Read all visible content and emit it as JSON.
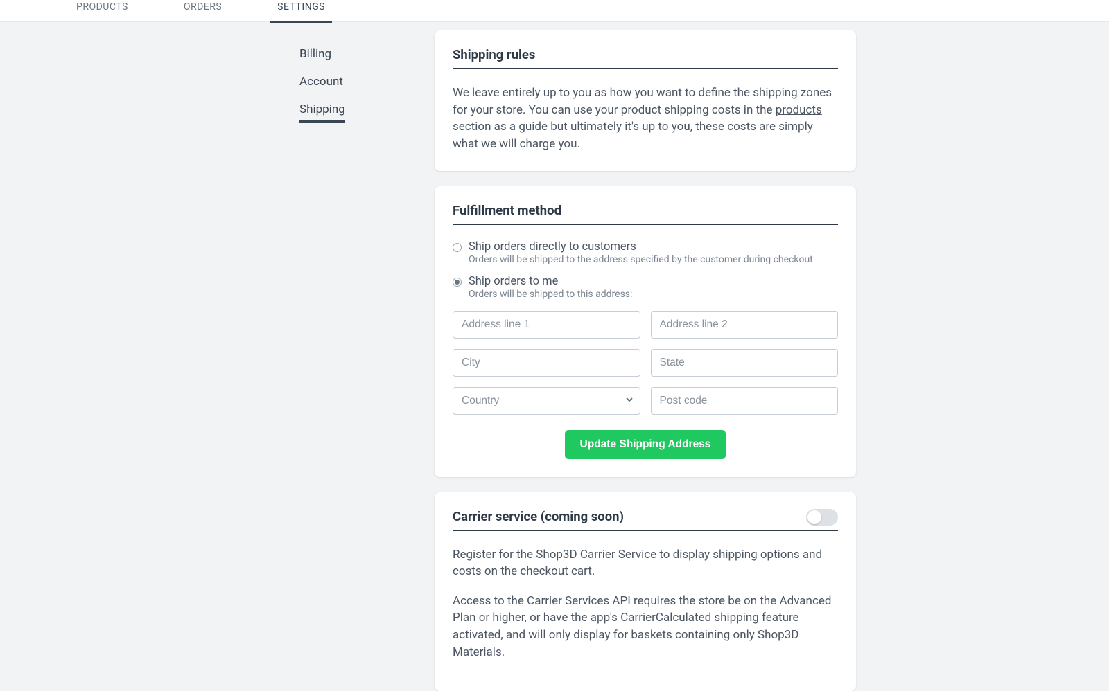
{
  "topnav": {
    "products": "PRODUCTS",
    "orders": "ORDERS",
    "settings": "SETTINGS"
  },
  "sidemenu": {
    "billing": "Billing",
    "account": "Account",
    "shipping": "Shipping"
  },
  "shipping_rules": {
    "title": "Shipping rules",
    "desc_1": "We leave entirely up to you as how you want to define the shipping zones for your store. You can use your product shipping costs in the ",
    "link": "products",
    "desc_2": " section as a guide but ultimately it's up to you, these costs are simply what we will charge you."
  },
  "fulfillment": {
    "title": "Fulfillment method",
    "opt1_label": "Ship orders directly to customers",
    "opt1_sub": "Orders will be shipped to the address specified by the customer during checkout",
    "opt2_label": "Ship orders to me",
    "opt2_sub": "Orders will be shipped to this address:",
    "selected": "to_me",
    "placeholders": {
      "addr1": "Address line 1",
      "addr2": "Address line 2",
      "city": "City",
      "state": "State",
      "country": "Country",
      "postcode": "Post code"
    },
    "button": "Update Shipping Address"
  },
  "carrier": {
    "title": "Carrier service (coming soon)",
    "toggle_on": false,
    "p1": "Register for the Shop3D Carrier Service to display shipping options and costs on the checkout cart.",
    "p2": "Access to the Carrier Services API requires the store be on the Advanced Plan or higher, or have the app's CarrierCalculated shipping feature activated, and will only display for baskets containing only Shop3D Materials."
  }
}
